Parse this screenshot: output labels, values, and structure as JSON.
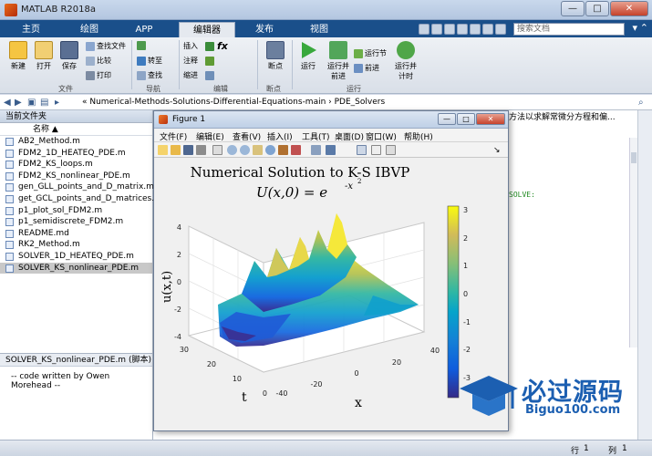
{
  "window": {
    "title": "MATLAB R2018a"
  },
  "tabs": [
    {
      "label": "主页"
    },
    {
      "label": "绘图"
    },
    {
      "label": "APP"
    },
    {
      "label": "编辑器"
    },
    {
      "label": "发布"
    },
    {
      "label": "视图"
    }
  ],
  "search": {
    "placeholder": "搜索文档"
  },
  "ribbon": {
    "file_group": "文件",
    "nav_group": "导航",
    "edit_group": "编辑",
    "bp_group": "断点",
    "run_group": "运行",
    "new": "新建",
    "open": "打开",
    "save": "保存",
    "find_files": "查找文件",
    "compare": "比较",
    "print": "打印",
    "goto": "转至",
    "find": "查找",
    "insert": "插入",
    "comment": "注释",
    "indent": "缩进",
    "fx": "fx",
    "breakpoints": "断点",
    "run": "运行",
    "run_advance": "运行并\n前进",
    "run_section": "运行节",
    "advance": "前进",
    "run_time": "运行并\n计时"
  },
  "address": {
    "path": "« Numerical-Methods-Solutions-Differential-Equations-main  ›  PDE_Solvers"
  },
  "current_folder": {
    "header": "当前文件夹",
    "col_name": "名称 ▲",
    "files": [
      "AB2_Method.m",
      "FDM2_1D_HEATEQ_PDE.m",
      "FDM2_KS_loops.m",
      "FDM2_KS_nonlinear_PDE.m",
      "gen_GLL_points_and_D_matrix.m",
      "get_GCL_points_and_D_matrices.m",
      "p1_plot_sol_FDM2.m",
      "p1_semidiscrete_FDM2.m",
      "README.md",
      "RK2_Method.m",
      "SOLVER_1D_HEATEQ_PDE.m",
      "SOLVER_KS_nonlinear_PDE.m"
    ],
    "selected_index": 11
  },
  "details": {
    "header": "SOLVER_KS_nonlinear_PDE.m  (脚本)",
    "text": "-- code written by Owen Morehead --"
  },
  "editor": {
    "tab_text": "方法以求解常微分方程和偏...",
    "code_text": "SOLVE:"
  },
  "status": {
    "row_label": "行",
    "row": "1",
    "col_label": "列",
    "col": "1"
  },
  "figure": {
    "title": "Figure 1",
    "menu": [
      "文件(F)",
      "编辑(E)",
      "查看(V)",
      "插入(I)",
      "工具(T)",
      "桌面(D)",
      "窗口(W)",
      "帮助(H)"
    ],
    "plot_title_1": "Numerical Solution to K-S IBVP",
    "plot_title_2": "U(x,0) = e",
    "plot_title_exp": "-x",
    "plot_title_exp2": "2",
    "ylabel": "u(x,t)",
    "xlabel": "x",
    "tlabel": "t"
  },
  "chart_data": {
    "type": "surface",
    "title": "Numerical Solution to K-S IBVP",
    "subtitle": "U(x,0) = e^{-x^2}",
    "xlabel": "x",
    "ylabel": "t",
    "zlabel": "u(x,t)",
    "x_ticks": [
      "-40",
      "-20",
      "0",
      "20",
      "40"
    ],
    "t_ticks": [
      "0",
      "10",
      "20",
      "30"
    ],
    "z_ticks": [
      "-4",
      "-2",
      "0",
      "2",
      "4"
    ],
    "colorbar_ticks": [
      "-3",
      "-2",
      "-1",
      "0",
      "1",
      "2",
      "3"
    ],
    "xlim": [
      -40,
      40
    ],
    "tlim": [
      0,
      30
    ],
    "zlim": [
      -4,
      4
    ],
    "clim": [
      -3.5,
      3.3
    ],
    "colormap": "parula"
  },
  "watermark": {
    "text": "必过源码",
    "url": "Biguo100.com"
  },
  "colors": {
    "tab_bar": "#1a4f8a",
    "accent": "#1c5fb1"
  }
}
